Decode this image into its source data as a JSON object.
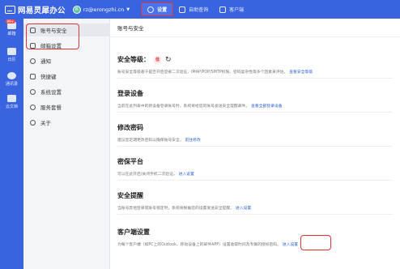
{
  "app": {
    "name": "网易灵犀办公"
  },
  "account": {
    "avatar_letter": "R",
    "email": "rz@erongzhi.cn"
  },
  "topnav": [
    {
      "label": "设置"
    },
    {
      "label": "自助查询"
    },
    {
      "label": "客户端"
    }
  ],
  "rail": [
    {
      "label": "邮箱",
      "badge": "99+"
    },
    {
      "label": "日历"
    },
    {
      "label": "通讯录"
    },
    {
      "label": "云文档"
    }
  ],
  "sidebar": {
    "items": [
      {
        "label": "账号与安全"
      },
      {
        "label": "邮箱设置"
      },
      {
        "label": "通知"
      },
      {
        "label": "快捷键"
      },
      {
        "label": "系统设置"
      },
      {
        "label": "服务套餐"
      },
      {
        "label": "关于"
      }
    ]
  },
  "main": {
    "header": "账号与安全",
    "sections": [
      {
        "title": "安全等级：",
        "badge": "低",
        "desc": "账号安全等级基于是否开启登录二次验证、IMAP/POP/SMTP权限、密码复杂性等多个因素来评估。",
        "link": "查看安全等级"
      },
      {
        "title": "登录设备",
        "desc": "当前在此列表中的新设备登录账号时，系统将给您的账号发送安全提醒邮件。",
        "link": "查看全部登录设备"
      },
      {
        "title": "修改密码",
        "desc": "建议您定期更改密码以确保账号安全。",
        "link": "前往修改"
      },
      {
        "title": "密保平台",
        "desc": "可以在此开启/关闭手机二次验证。",
        "link": "进入设置"
      },
      {
        "title": "安全提醒",
        "desc": "当账号异地登录或账号锁定时，系统将根据您的设置发送安全提醒。",
        "link": "进入设置"
      },
      {
        "title": "客户端设置",
        "desc": "为每个客户端（如PC上的Outlook、移动设备上的邮件APP）设置收取时间及专属的授权密码。",
        "link": "进入设置"
      }
    ]
  },
  "colors": {
    "brand": "#3a63e0",
    "link": "#2f63d8",
    "highlight": "#e23535"
  }
}
